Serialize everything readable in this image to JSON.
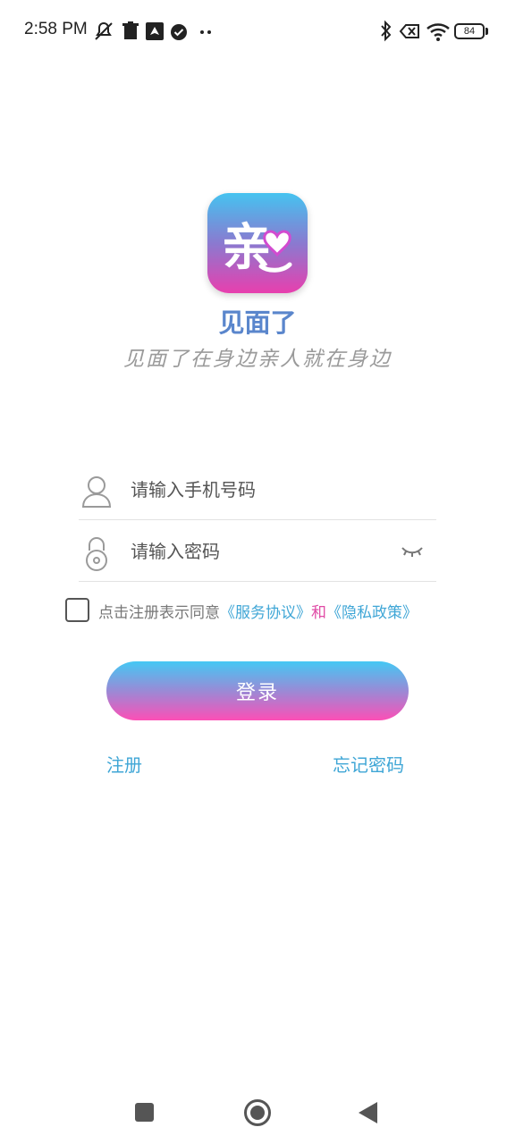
{
  "status_bar": {
    "time": "2:58 PM",
    "battery": "84"
  },
  "app": {
    "name": "见面了",
    "slogan": "见面了在身边亲人就在身边",
    "logo_text": "亲",
    "colors": {
      "logo_top": "#45c3f0",
      "logo_bottom": "#e83fae",
      "name": "#5a86cc"
    }
  },
  "form": {
    "phone_placeholder": "请输入手机号码",
    "phone_value": "",
    "password_placeholder": "请输入密码",
    "password_value": ""
  },
  "agreement": {
    "checked": false,
    "prefix": "点击注册表示同意",
    "service_link": "《服务协议》",
    "conjunction": "和",
    "privacy_link": "《隐私政策》"
  },
  "actions": {
    "login_label": "登录",
    "register_label": "注册",
    "forgot_label": "忘记密码"
  },
  "colors": {
    "link": "#3fa6d6",
    "accent_pink": "#e04aa5",
    "button_gradient_top": "#44c8f4",
    "button_gradient_bottom": "#fd4fb6"
  }
}
